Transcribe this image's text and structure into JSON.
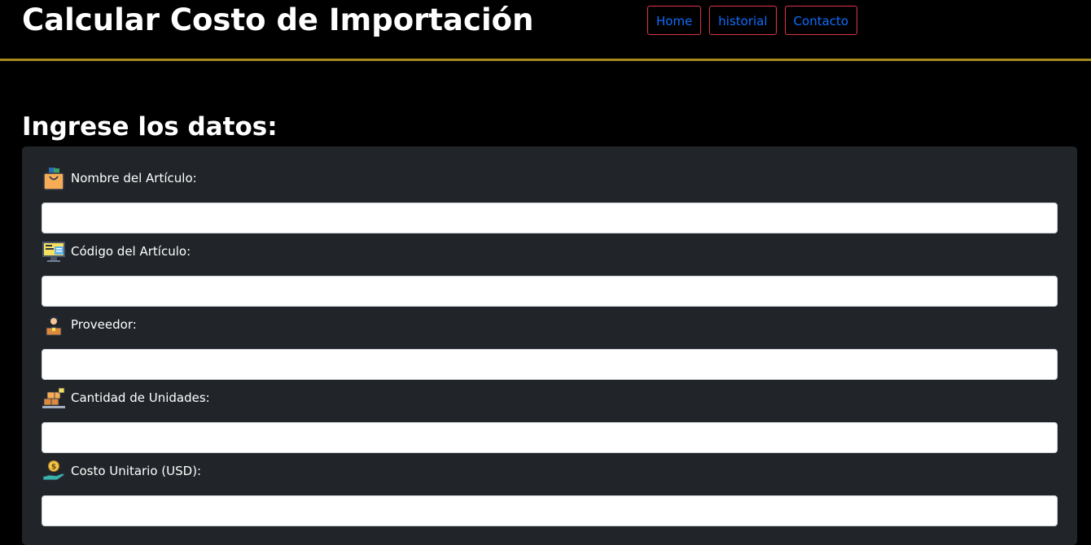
{
  "header": {
    "title": "Calcular Costo de Importación",
    "nav": [
      {
        "label": "Home"
      },
      {
        "label": "historial"
      },
      {
        "label": "Contacto"
      }
    ],
    "colors": {
      "background": "#000000",
      "divider": "#a48a1d",
      "nav_border": "#dc3545",
      "nav_text": "#0d6efd"
    }
  },
  "form": {
    "heading": "Ingrese los datos:",
    "panel_color": "#212529",
    "fields": [
      {
        "label": "Nombre del Artículo:",
        "icon": "shopping-bag-icon",
        "value": "",
        "placeholder": ""
      },
      {
        "label": "Código del Artículo:",
        "icon": "code-monitor-icon",
        "value": "",
        "placeholder": ""
      },
      {
        "label": "Proveedor:",
        "icon": "supplier-icon",
        "value": "",
        "placeholder": ""
      },
      {
        "label": "Cantidad de Unidades:",
        "icon": "boxes-icon",
        "value": "",
        "placeholder": ""
      },
      {
        "label": "Costo Unitario (USD):",
        "icon": "coin-hand-icon",
        "value": "",
        "placeholder": ""
      }
    ]
  }
}
